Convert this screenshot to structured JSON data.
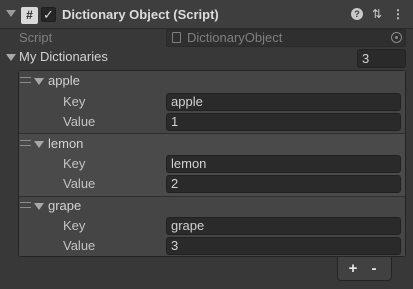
{
  "component": {
    "title": "Dictionary Object (Script)",
    "script_label": "Script",
    "script_value": "DictionaryObject",
    "icons": [
      "foldout-arrow-icon",
      "script-icon",
      "enabled-checkbox",
      "help-icon",
      "presets-icon",
      "context-menu-icon",
      "object-picker-icon"
    ]
  },
  "list": {
    "label": "My Dictionaries",
    "size": "3",
    "key_label": "Key",
    "value_label": "Value",
    "items": [
      {
        "label": "apple",
        "key": "apple",
        "value": "1"
      },
      {
        "label": "lemon",
        "key": "lemon",
        "value": "2"
      },
      {
        "label": "grape",
        "key": "grape",
        "value": "3"
      }
    ],
    "add_label": "+",
    "remove_label": "-"
  }
}
